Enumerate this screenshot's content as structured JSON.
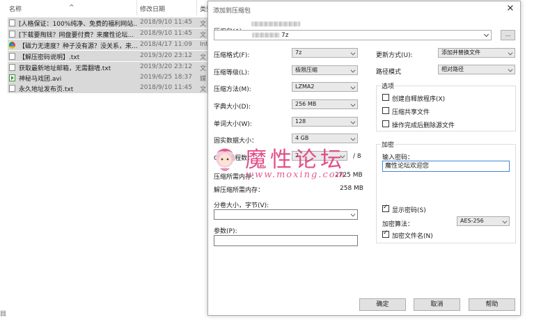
{
  "explorer": {
    "columns": {
      "name": "名称",
      "date": "修改日期",
      "type": "类型"
    },
    "files": [
      {
        "name": "[人格保证：100%纯净、免费的福利网站...",
        "date": "2018/9/10 11:45",
        "type": "文",
        "icon": "text-file-icon"
      },
      {
        "name": "[下载要掏钱？网盘要付费？来魔性论坛...",
        "date": "2018/9/10 11:45",
        "type": "文",
        "icon": "text-file-icon"
      },
      {
        "name": "【磁力无速度？种子没有源？没关系，来...",
        "date": "2018/4/17 11:09",
        "type": "Int",
        "icon": "chrome-icon"
      },
      {
        "name": "【解压密码说明】.txt",
        "date": "2019/3/20 23:12",
        "type": "文",
        "icon": "text-file-icon"
      },
      {
        "name": "获取最新地址邮箱，无需翻墙.txt",
        "date": "2019/3/20 23:12",
        "type": "文",
        "icon": "text-file-icon"
      },
      {
        "name": "神秘马戏团.avi",
        "date": "2019/6/25 18:37",
        "type": "媒",
        "icon": "video-file-icon"
      },
      {
        "name": "永久地址发布页.txt",
        "date": "2018/9/10 11:45",
        "type": "文",
        "icon": "text-file-icon"
      }
    ],
    "gutter": "目"
  },
  "dialog": {
    "title": "添加到压缩包",
    "close": "✕",
    "archive_label": "压缩包(A)",
    "archive_path_tail": "7z",
    "browse": "...",
    "format_label": "压缩格式(F):",
    "format_value": "7z",
    "level_label": "压缩等级(L):",
    "level_value": "极限压缩",
    "method_label": "压缩方法(M):",
    "method_value": "LZMA2",
    "dict_label": "字典大小(D):",
    "dict_value": "256 MB",
    "word_label": "单词大小(W):",
    "word_value": "128",
    "solid_label": "固实数据大小：",
    "solid_value": "4 GB",
    "cpu_label": "CPU 线程数：",
    "cpu_value": "2",
    "cpu_max": "/ 8",
    "mem_comp_label": "压缩所需内存：",
    "mem_comp_value": "2725 MB",
    "mem_decomp_label": "解压缩所需内存：",
    "mem_decomp_value": "258 MB",
    "split_label": "分卷大小，字节(V):",
    "split_value": "",
    "params_label": "参数(P):",
    "params_value": "",
    "update_label": "更新方式(U):",
    "update_value": "添加并替换文件",
    "path_label": "路径模式",
    "path_value": "相对路径",
    "options_title": "选项",
    "opt_sfx": "创建自释放程序(X)",
    "opt_shared": "压缩共享文件",
    "opt_delete": "操作完成后删除源文件",
    "encrypt_title": "加密",
    "password_label": "输入密码：",
    "password_value": "魔性论坛欢迎您",
    "show_password": "显示密码(S)",
    "enc_method_label": "加密算法：",
    "enc_method_value": "AES-256",
    "encrypt_names": "加密文件名(N)",
    "ok": "确定",
    "cancel": "取消",
    "help": "帮助"
  },
  "watermark": {
    "title": "魔性论坛",
    "url": "www.moxing.com"
  }
}
